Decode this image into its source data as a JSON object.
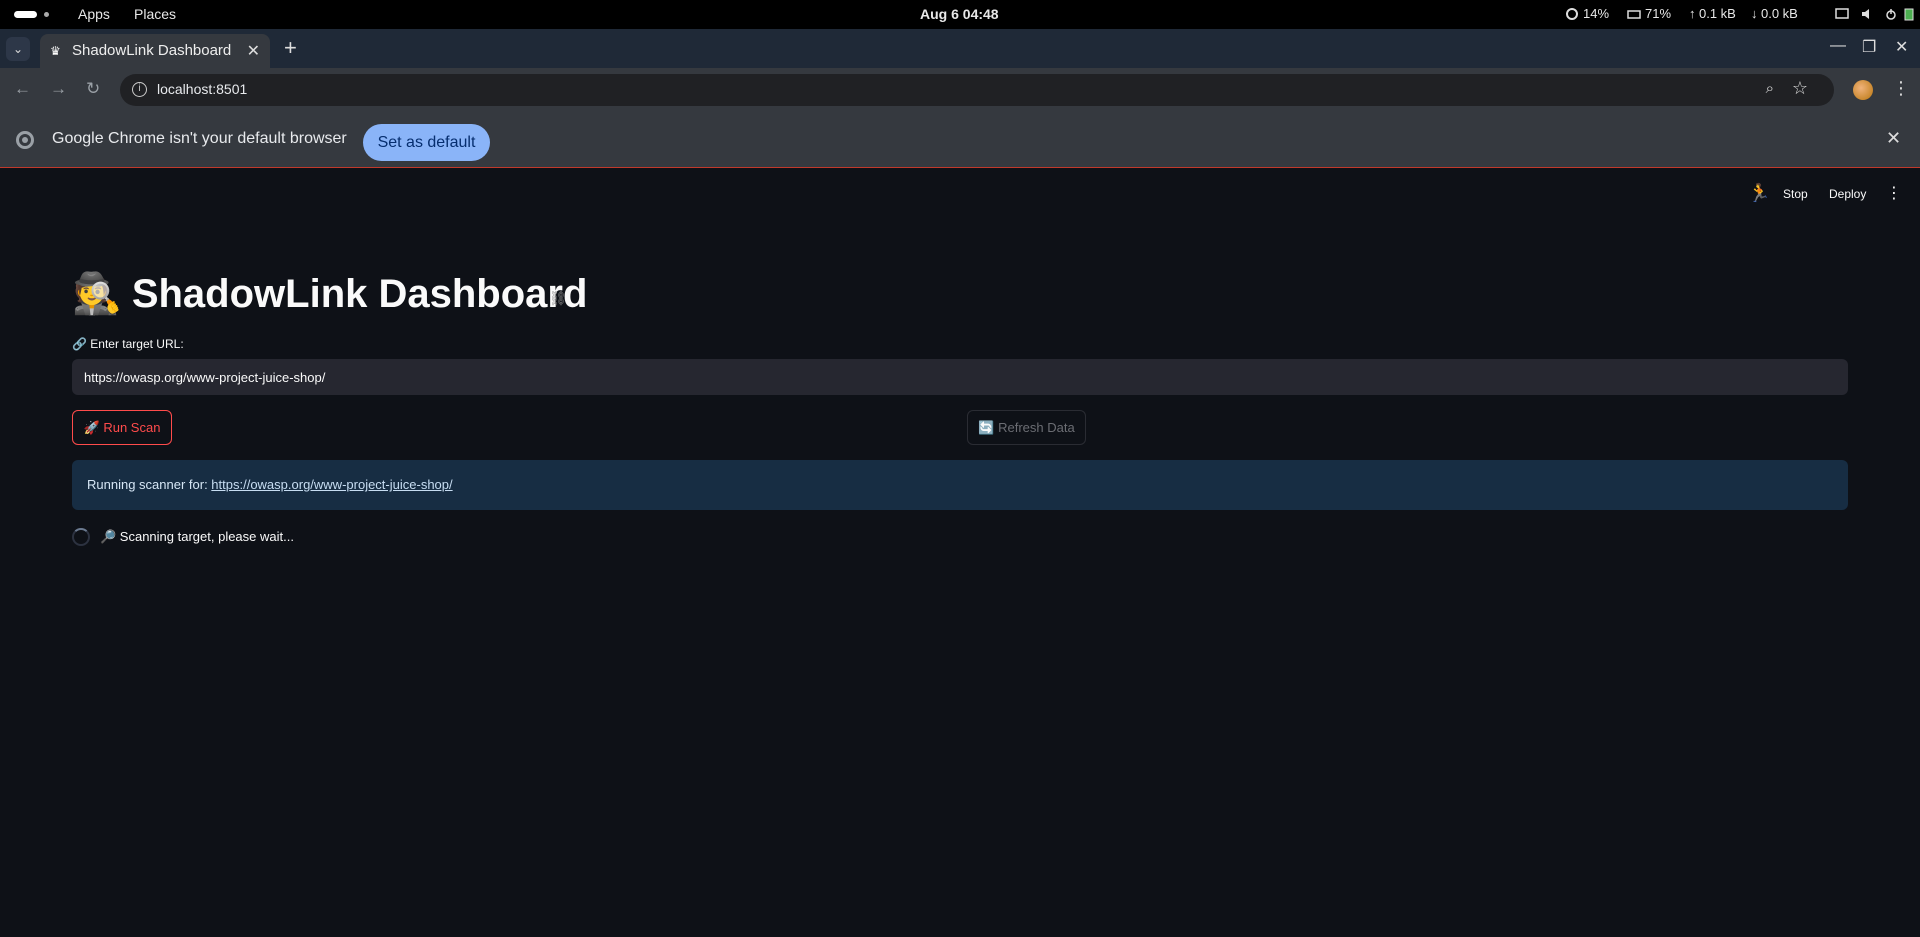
{
  "system_bar": {
    "apps": "Apps",
    "places": "Places",
    "clock": "Aug 6  04:48",
    "cpu": "14%",
    "memory": "71%",
    "upload": "0.1 kB",
    "download": "0.0 kB"
  },
  "browser": {
    "tab_title": "ShadowLink Dashboard",
    "url": "localhost:8501",
    "infobar_message": "Google Chrome isn't your default browser",
    "infobar_button": "Set as default"
  },
  "streamlit_header": {
    "stop": "Stop",
    "deploy": "Deploy"
  },
  "main": {
    "title_emoji": "🕵️",
    "title": "ShadowLink Dashboard",
    "url_label": "🔗 Enter target URL:",
    "url_value": "https://owasp.org/www-project-juice-shop/",
    "run_button": "🚀 Run Scan",
    "refresh_button": "🔄 Refresh Data",
    "info_prefix": "Running scanner for: ",
    "info_link": "https://owasp.org/www-project-juice-shop/",
    "scan_status": "🔎 Scanning target, please wait..."
  },
  "colors": {
    "background": "#0e1117",
    "primary": "#ff4b4b",
    "info_bg": "#172d43",
    "input_bg": "#262730"
  }
}
